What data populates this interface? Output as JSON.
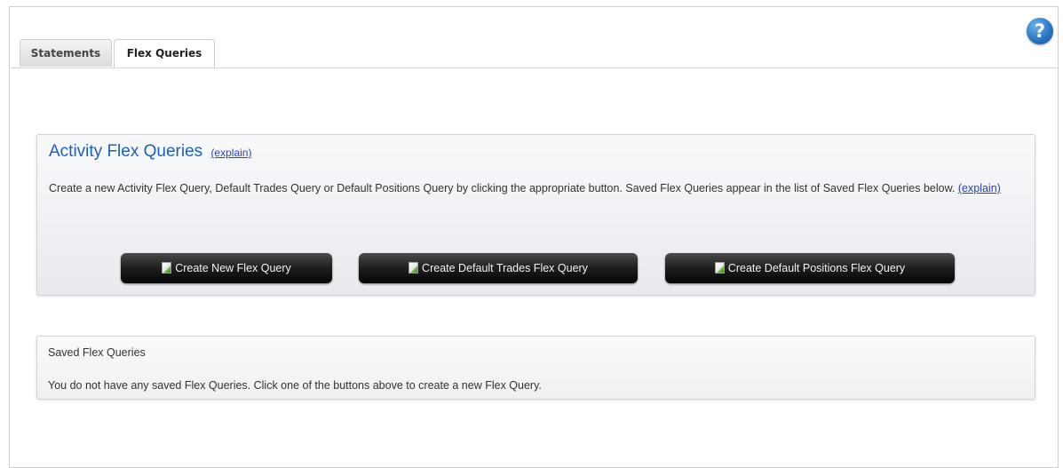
{
  "tabs": [
    {
      "label": "Statements"
    },
    {
      "label": "Flex Queries"
    }
  ],
  "help": {
    "glyph": "?"
  },
  "activity": {
    "title": "Activity Flex Queries",
    "explain_link": "(explain)",
    "description": "Create a new Activity Flex Query, Default Trades Query or Default Positions Query by clicking the appropriate button. Saved Flex Queries appear in the list of Saved Flex Queries below.",
    "description_link": "(explain)",
    "buttons": {
      "new": "Create New Flex Query",
      "trades": "Create Default Trades Flex Query",
      "positions": "Create Default Positions Flex Query"
    }
  },
  "saved": {
    "title": "Saved Flex Queries",
    "message": "You do not have any saved Flex Queries. Click one of the buttons above to create a new Flex Query."
  },
  "colors": {
    "title_blue": "#1f5fbf",
    "link_blue": "#2a3fbf",
    "button_dark": "#1e1e1e",
    "help_blue": "#2a78c6"
  }
}
